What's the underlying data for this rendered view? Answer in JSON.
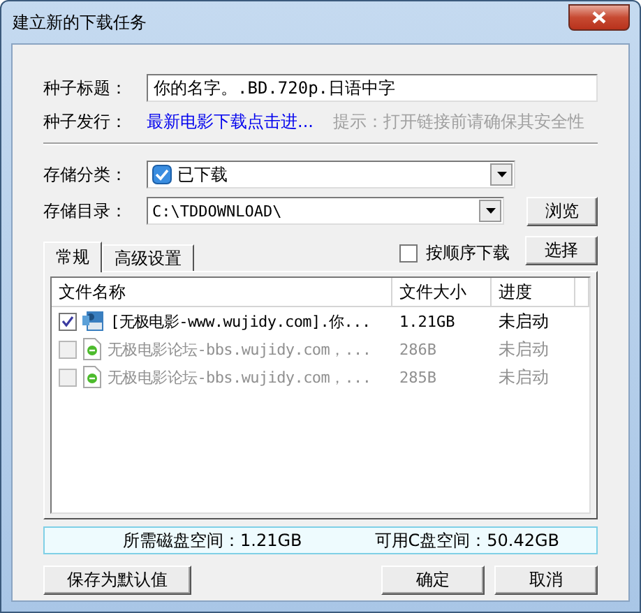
{
  "window": {
    "title": "建立新的下载任务"
  },
  "torrent_title": {
    "label": "种子标题：",
    "value": "你的名字。.BD.720p.日语中字"
  },
  "publisher": {
    "label": "种子发行：",
    "link": "最新电影下载点击进...",
    "hint": "提示：打开链接前请确保其安全性"
  },
  "category": {
    "label": "存储分类：",
    "value": "已下载"
  },
  "directory": {
    "label": "存储目录：",
    "value": "C:\\TDDOWNLOAD\\",
    "button": "浏览"
  },
  "tabs": [
    {
      "label": "常规",
      "selected": true
    },
    {
      "label": "高级设置",
      "selected": false
    }
  ],
  "sequential": {
    "label": "按顺序下载",
    "checked": false
  },
  "select_button": "选择",
  "table": {
    "columns": [
      "文件名称",
      "文件大小",
      "进度"
    ],
    "rows": [
      {
        "kind": "video",
        "checked": true,
        "disabled": false,
        "name": "[无极电影-www.wujidy.com].你...",
        "size": "1.21GB",
        "progress": "未启动"
      },
      {
        "kind": "web",
        "checked": false,
        "disabled": true,
        "name": "无极电影论坛-bbs.wujidy.com，...",
        "size": "286B",
        "progress": "未启动"
      },
      {
        "kind": "web",
        "checked": false,
        "disabled": true,
        "name": "无极电影论坛-bbs.wujidy.com，...",
        "size": "285B",
        "progress": "未启动"
      }
    ]
  },
  "status": {
    "required": "所需磁盘空间：1.21GB",
    "free": "可用C盘空间：50.42GB"
  },
  "buttons": {
    "save_default": "保存为默认值",
    "ok": "确定",
    "cancel": "取消"
  }
}
